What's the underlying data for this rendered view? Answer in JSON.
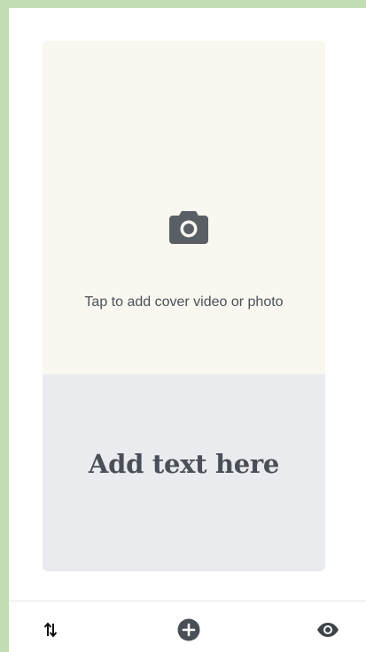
{
  "cover": {
    "icon": "camera-icon",
    "label": "Tap to add cover video or photo",
    "background": "#f9f7ef"
  },
  "text_block": {
    "label": "Add text here",
    "background": "#e9ebee"
  },
  "toolbar": {
    "reorder_icon": "reorder-arrows-icon",
    "add_icon": "plus-circle-icon",
    "preview_icon": "eye-icon"
  },
  "colors": {
    "frame_border": "#c3ddb3",
    "icon": "#5a5f66",
    "text": "#4b5058"
  }
}
